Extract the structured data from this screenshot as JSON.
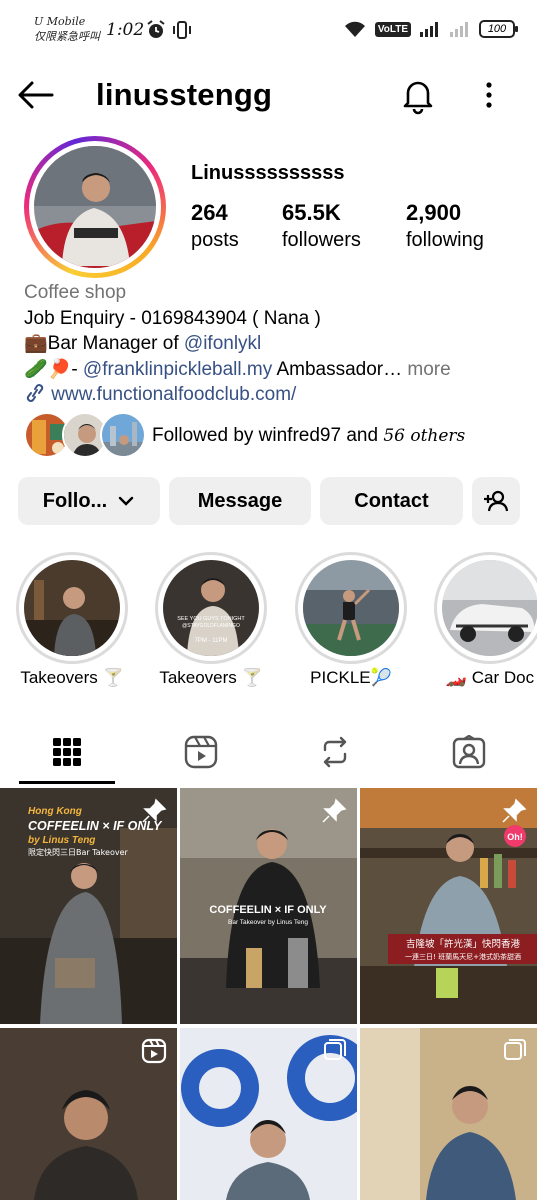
{
  "status_bar": {
    "carrier_line1": "U Mobile",
    "carrier_line2": "仅限紧急呼叫",
    "time": "1:02",
    "network": "VoLTE",
    "battery": "100"
  },
  "header": {
    "username": "linusstengg",
    "icons": [
      "back-arrow-icon",
      "bell-icon",
      "more-vertical-icon"
    ]
  },
  "profile": {
    "display_name": "Linussssssssss",
    "stats": {
      "posts": {
        "value": "264",
        "label": "posts"
      },
      "followers": {
        "value": "65.5K",
        "label": "followers"
      },
      "following": {
        "value": "2,900",
        "label": "following"
      }
    },
    "bio": {
      "category": "Coffee shop",
      "line1": "Job Enquiry - 0169843904 ( Nana )",
      "line2_prefix": "💼Bar Manager of ",
      "line2_mention": "@ifonlykl",
      "line3_prefix": "🥒🏓- ",
      "line3_mention": "@franklinpickleball.my",
      "line3_suffix": " Ambassador…",
      "more": " more",
      "link": "www.functionalfoodclub.com/"
    },
    "followed_by": {
      "prefix": "Followed by winfred97 and ",
      "suffix": "56 others"
    }
  },
  "actions": {
    "follow": "Follo...",
    "message": "Message",
    "contact": "Contact"
  },
  "highlights": [
    {
      "label": "Takeovers 🍸"
    },
    {
      "label": "Takeovers 🍸"
    },
    {
      "label": "PICKLE🎾"
    },
    {
      "label": "🏎️ Car Doc"
    }
  ],
  "highlight_overlay": {
    "line1": "SEE YOU GUYS TONIGHT",
    "line2": "@STAYGOLDFLAMINGO",
    "line3": "7PM - 11PM"
  },
  "tabs": [
    "grid-icon",
    "reels-icon",
    "reposts-icon",
    "tagged-icon"
  ],
  "posts": {
    "p1": {
      "line1": "Hong Kong",
      "line2": "COFFEELIN × IF ONLY",
      "line3": "by Linus Teng",
      "line4": "限定快閃三日Bar Takeover"
    },
    "p2": {
      "line1": "COFFEELIN × IF ONLY",
      "line2": "Bar Takeover by Linus Teng"
    },
    "p3": {
      "line1": "吉隆坡「許光漢」快閃香港",
      "line2": "一連三日! 班蘭馬天尼+港式奶茶甜酒",
      "sign": "Oh!"
    }
  },
  "colors": {
    "link": "#385185",
    "muted": "#737373",
    "button_bg": "#efefef"
  }
}
